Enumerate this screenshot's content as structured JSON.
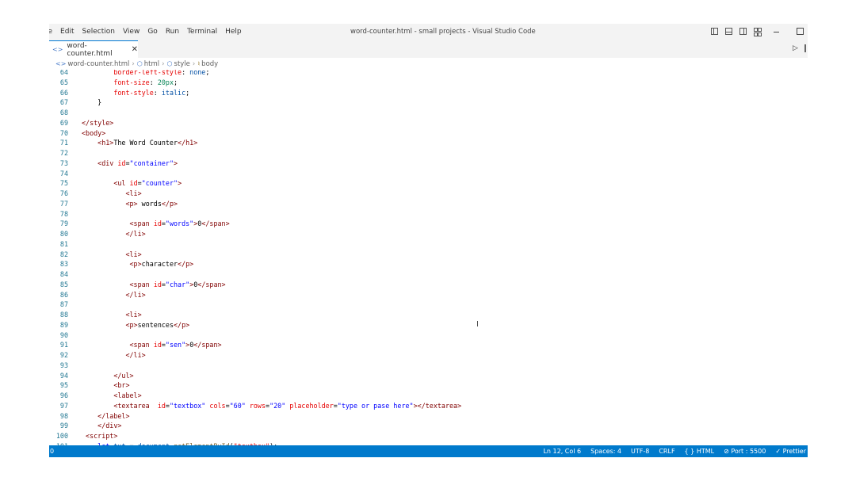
{
  "menu": [
    "le",
    "Edit",
    "Selection",
    "View",
    "Go",
    "Run",
    "Terminal",
    "Help"
  ],
  "window_title": "word-counter.html - small projects - Visual Studio Code",
  "tab": {
    "label": "word-counter.html",
    "close": "✕"
  },
  "breadcrumb": {
    "file": "word-counter.html",
    "html": "html",
    "style": "style",
    "body": "body"
  },
  "code_lines": [
    {
      "n": "64",
      "html": "<span class=\"p\">        border-left-style</span>: <span class=\"v\">none</span>;"
    },
    {
      "n": "65",
      "html": "<span class=\"p\">        font-size</span>: <span class=\"n\">20px</span>;"
    },
    {
      "n": "66",
      "html": "<span class=\"p\">        font-style</span>: <span class=\"v\">italic</span>;"
    },
    {
      "n": "67",
      "html": "    }"
    },
    {
      "n": "68",
      "html": ""
    },
    {
      "n": "69",
      "html": "<span class=\"t\">&lt;/style&gt;</span>"
    },
    {
      "n": "70",
      "html": "<span class=\"t\">&lt;body&gt;</span>"
    },
    {
      "n": "71",
      "html": "    <span class=\"t\">&lt;h1&gt;</span>The Word Counter<span class=\"t\">&lt;/h1&gt;</span>"
    },
    {
      "n": "72",
      "html": ""
    },
    {
      "n": "73",
      "html": "    <span class=\"t\">&lt;div</span> <span class=\"a\">id</span>=<span class=\"s\">\"container\"</span><span class=\"t\">&gt;</span>"
    },
    {
      "n": "74",
      "html": ""
    },
    {
      "n": "75",
      "html": "        <span class=\"t\">&lt;ul</span> <span class=\"a\">id</span>=<span class=\"s\">\"counter\"</span><span class=\"t\">&gt;</span>"
    },
    {
      "n": "76",
      "html": "           <span class=\"t\">&lt;li&gt;</span>"
    },
    {
      "n": "77",
      "html": "           <span class=\"t\">&lt;p&gt;</span> words<span class=\"t\">&lt;/p&gt;</span>"
    },
    {
      "n": "78",
      "html": ""
    },
    {
      "n": "79",
      "html": "            <span class=\"t\">&lt;span</span> <span class=\"a\">id</span>=<span class=\"s\">\"words\"</span><span class=\"t\">&gt;</span>0<span class=\"t\">&lt;/span&gt;</span>"
    },
    {
      "n": "80",
      "html": "           <span class=\"t\">&lt;/li&gt;</span>"
    },
    {
      "n": "81",
      "html": ""
    },
    {
      "n": "82",
      "html": "           <span class=\"t\">&lt;li&gt;</span>"
    },
    {
      "n": "83",
      "html": "            <span class=\"t\">&lt;p&gt;</span>character<span class=\"t\">&lt;/p&gt;</span>"
    },
    {
      "n": "84",
      "html": ""
    },
    {
      "n": "85",
      "html": "            <span class=\"t\">&lt;span</span> <span class=\"a\">id</span>=<span class=\"s\">\"char\"</span><span class=\"t\">&gt;</span>0<span class=\"t\">&lt;/span&gt;</span>"
    },
    {
      "n": "86",
      "html": "           <span class=\"t\">&lt;/li&gt;</span>"
    },
    {
      "n": "87",
      "html": ""
    },
    {
      "n": "88",
      "html": "           <span class=\"t\">&lt;li&gt;</span>"
    },
    {
      "n": "89",
      "html": "           <span class=\"t\">&lt;p&gt;</span>sentences<span class=\"t\">&lt;/p&gt;</span>"
    },
    {
      "n": "90",
      "html": ""
    },
    {
      "n": "91",
      "html": "            <span class=\"t\">&lt;span</span> <span class=\"a\">id</span>=<span class=\"s\">\"sen\"</span><span class=\"t\">&gt;</span>0<span class=\"t\">&lt;/span&gt;</span>"
    },
    {
      "n": "92",
      "html": "           <span class=\"t\">&lt;/li&gt;</span>"
    },
    {
      "n": "93",
      "html": ""
    },
    {
      "n": "94",
      "html": "        <span class=\"t\">&lt;/ul&gt;</span>"
    },
    {
      "n": "95",
      "html": "        <span class=\"t\">&lt;br&gt;</span>"
    },
    {
      "n": "96",
      "html": "        <span class=\"t\">&lt;label&gt;</span>"
    },
    {
      "n": "97",
      "html": "        <span class=\"t\">&lt;textarea</span>  <span class=\"a\">id</span>=<span class=\"s\">\"textbox\"</span> <span class=\"a\">cols</span>=<span class=\"s\">\"60\"</span> <span class=\"a\">rows</span>=<span class=\"s\">\"20\"</span> <span class=\"a\">placeholder</span>=<span class=\"s\">\"type or pase here\"</span><span class=\"t\">&gt;&lt;/textarea&gt;</span>"
    },
    {
      "n": "98",
      "html": "    <span class=\"t\">&lt;/label&gt;</span>"
    },
    {
      "n": "99",
      "html": "    <span class=\"t\">&lt;/div&gt;</span>"
    },
    {
      "n": "100",
      "html": " <span class=\"t\">&lt;script&gt;</span>"
    },
    {
      "n": "101",
      "html": "    <span class=\"js\">let</span> <span class=\"v\">txt</span> = <span class=\"v\">document</span>.<span class=\"fn\">getElementById</span>(<span class=\"a\">\"textbox\"</span>);"
    }
  ],
  "status": {
    "left": "0",
    "ln_col": "Ln 12, Col 6",
    "spaces": "Spaces: 4",
    "encoding": "UTF-8",
    "eol": "CRLF",
    "language": "{ } HTML",
    "port": "⊘ Port : 5500",
    "prettier": "✓ Prettier"
  }
}
